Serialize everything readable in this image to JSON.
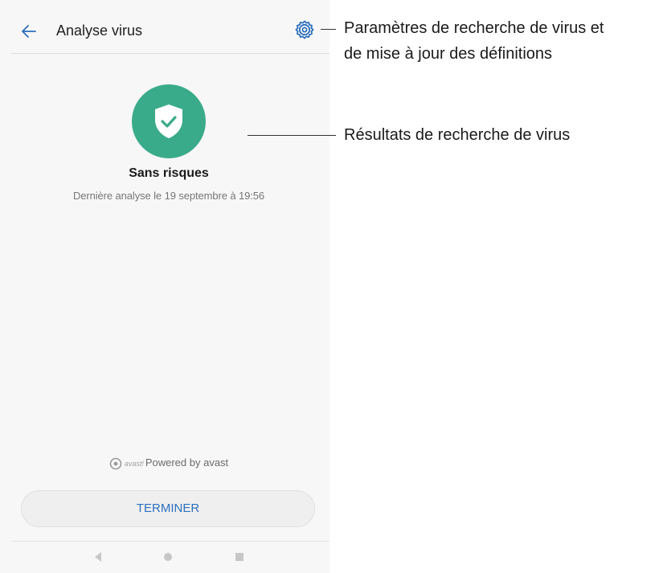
{
  "app": {
    "title": "Analyse virus",
    "back_icon": "arrow-left-icon",
    "settings_icon": "gear-icon"
  },
  "result": {
    "icon": "shield-check-icon",
    "status": "Sans risques",
    "last_scan": "Dernière analyse le 19 septembre à 19:56",
    "accent_color": "#3aab8a"
  },
  "footer": {
    "powered_by_brand": "avast!",
    "powered_by": "Powered by avast",
    "finish_button": "TERMINER"
  },
  "navbar": {
    "back_icon": "triangle-back-icon",
    "home_icon": "circle-home-icon",
    "recent_icon": "square-recent-icon"
  },
  "callouts": {
    "settings_line1": "Paramètres de recherche de virus et",
    "settings_line2": "de mise à jour des définitions",
    "results": "Résultats de recherche de virus"
  }
}
